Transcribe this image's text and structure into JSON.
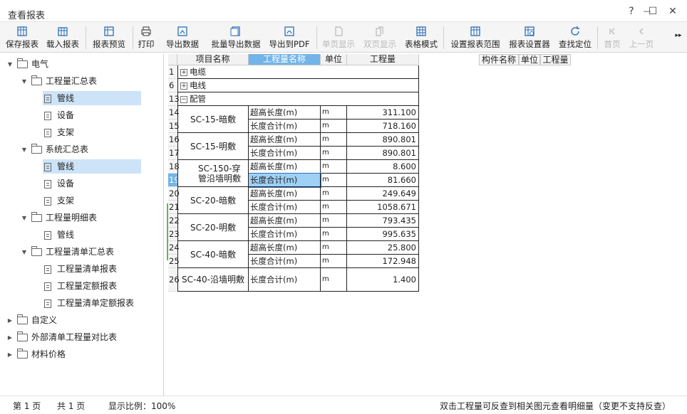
{
  "window": {
    "title": "查看报表",
    "help": "?",
    "minimize": "—",
    "maximize": "☐",
    "close": "✕"
  },
  "toolbar": {
    "save_report": "保存报表",
    "load_report": "载入报表",
    "preview_report": "报表预览",
    "print": "打印",
    "export_data": "导出数据",
    "batch_export": "批量导出数据",
    "export_pdf": "导出到PDF",
    "single_page": "单页显示",
    "double_page": "双页显示",
    "table_mode": "表格模式",
    "set_range": "设置报表范围",
    "report_settings": "报表设置器",
    "find_locate": "查找定位",
    "first_page": "首页",
    "prev_page": "上一页",
    "more": "▸▸"
  },
  "tree": {
    "root": "电气",
    "group1": "工程量汇总表",
    "group1_items": [
      "管线",
      "设备",
      "支架"
    ],
    "group2": "系统汇总表",
    "group2_items": [
      "管线",
      "设备",
      "支架"
    ],
    "group3": "工程量明细表",
    "group3_items": [
      "管线"
    ],
    "group4": "工程量清单汇总表",
    "group4_items": [
      "工程量清单报表",
      "工程量定额报表",
      "工程量清单定额报表"
    ],
    "other1": "自定义",
    "other2": "外部清单工程量对比表",
    "other3": "材料价格"
  },
  "table": {
    "headers": [
      "项目名称",
      "工程量名称",
      "单位",
      "工程量"
    ],
    "groups": [
      {
        "row": "1",
        "name": "电缆",
        "sign": "+"
      },
      {
        "row": "6",
        "name": "电线",
        "sign": "+"
      },
      {
        "row": "13",
        "name": "配管",
        "sign": "−"
      }
    ],
    "rows": [
      {
        "n": "14",
        "qty_name": "超高长度(m)",
        "unit": "m",
        "qty": "311.100"
      },
      {
        "n": "15",
        "qty_name": "长度合计(m)",
        "unit": "m",
        "qty": "718.160"
      },
      {
        "n": "16",
        "qty_name": "超高长度(m)",
        "unit": "m",
        "qty": "890.801"
      },
      {
        "n": "17",
        "qty_name": "长度合计(m)",
        "unit": "m",
        "qty": "890.801"
      },
      {
        "n": "18",
        "qty_name": "超高长度(m)",
        "unit": "m",
        "qty": "8.600"
      },
      {
        "n": "19",
        "qty_name": "长度合计(m)",
        "unit": "m",
        "qty": "81.660"
      },
      {
        "n": "20",
        "qty_name": "超高长度(m)",
        "unit": "m",
        "qty": "249.649"
      },
      {
        "n": "21",
        "qty_name": "长度合计(m)",
        "unit": "m",
        "qty": "1058.671"
      },
      {
        "n": "22",
        "qty_name": "超高长度(m)",
        "unit": "m",
        "qty": "793.435"
      },
      {
        "n": "23",
        "qty_name": "长度合计(m)",
        "unit": "m",
        "qty": "995.635"
      },
      {
        "n": "24",
        "qty_name": "超高长度(m)",
        "unit": "m",
        "qty": "25.800"
      },
      {
        "n": "25",
        "qty_name": "长度合计(m)",
        "unit": "m",
        "qty": "172.948"
      },
      {
        "n": "26",
        "qty_name": "长度合计(m)",
        "unit": "m",
        "qty": "1.400"
      }
    ],
    "items": [
      "SC-15-暗敷",
      "SC-15-明敷",
      "SC-150-穿管沿墙明敷",
      "SC-20-暗敷",
      "SC-20-明敷",
      "SC-40-暗敷",
      "SC-40-沿墙明敷"
    ]
  },
  "right_headers": [
    "构件名称",
    "单位",
    "工程量"
  ],
  "status": {
    "page": "第  1  页",
    "total": "共  1  页",
    "zoom": "显示比例：100%",
    "hint": "双击工程量可反查到相关图元查看明细量（变更不支持反查）"
  }
}
